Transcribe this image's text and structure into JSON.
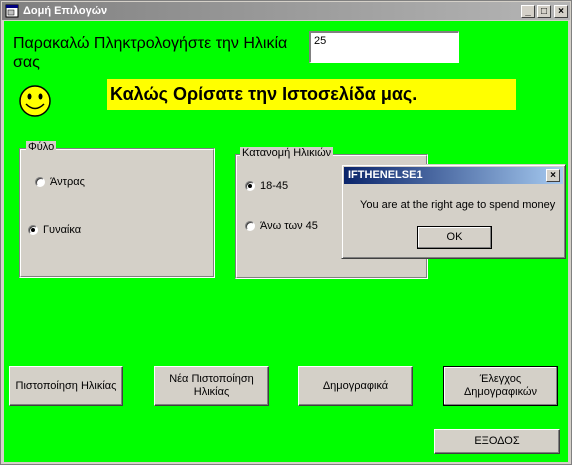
{
  "window": {
    "title": "Δομή Επιλογών"
  },
  "form": {
    "prompt": "Παρακαλώ Πληκτρολογήστε την Ηλικία σας",
    "age_value": "25",
    "welcome": "Καλώς Ορίσατε την Ιστοσελίδα μας."
  },
  "gender_frame": {
    "title": "Φύλο",
    "options": [
      {
        "label": "Άντρας",
        "checked": false
      },
      {
        "label": "Γυναίκα",
        "checked": true
      }
    ]
  },
  "age_frame": {
    "title": "Κατανομή Ηλικιών",
    "options": [
      {
        "label": "18-45",
        "checked": true
      },
      {
        "label": "Άνω των 45",
        "checked": false
      }
    ]
  },
  "buttons": {
    "verify": "Πιστοποίηση Ηλικίας",
    "new_verify": "Νέα Πιστοποίηση Ηλικίας",
    "demographics": "Δημογραφικά",
    "check_demographics": "Έλεγχος Δημογραφικών",
    "exit": "ΕΞΟΔΟΣ"
  },
  "dialog": {
    "title": "IFTHENELSE1",
    "message": "You are at the right age to spend money",
    "ok": "OK"
  },
  "colors": {
    "background": "#00ff00",
    "banner": "#ffff00",
    "dialog_title": "#0a246a"
  }
}
